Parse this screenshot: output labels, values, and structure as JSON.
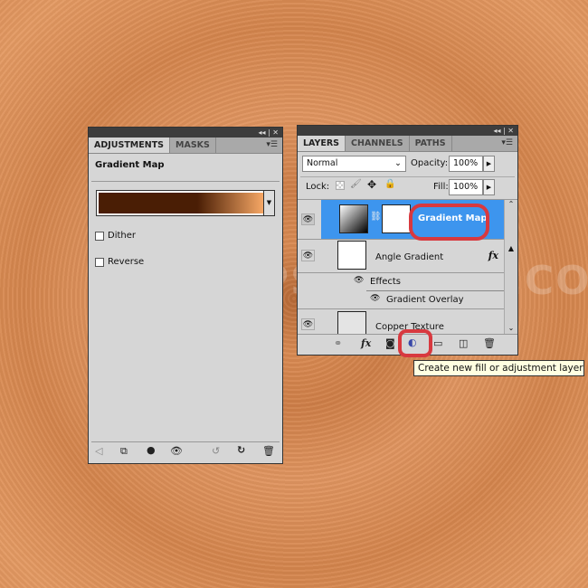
{
  "watermark": "WWW.PSD-DUDE.COM",
  "adjustments": {
    "tabs": [
      "ADJUSTMENTS",
      "MASKS"
    ],
    "title": "Gradient Map",
    "gradient_colors": [
      "#4a1e05",
      "#4a1e05",
      "#f6a765"
    ],
    "dither_label": "Dither",
    "dither_checked": false,
    "reverse_label": "Reverse",
    "reverse_checked": false,
    "toolbar_icons": [
      "back-arrow-icon",
      "expand-view-icon",
      "clip-layer-icon",
      "visibility-eye-icon",
      "view-previous-icon",
      "reset-icon",
      "trash-icon"
    ]
  },
  "layers": {
    "tabs": [
      "LAYERS",
      "CHANNELS",
      "PATHS"
    ],
    "blend_mode": "Normal",
    "opacity_label": "Opacity:",
    "opacity": "100%",
    "lock_label": "Lock:",
    "fill_label": "Fill:",
    "fill": "100%",
    "items": [
      {
        "name": "Gradient Map",
        "selected": true
      },
      {
        "name": "Angle Gradient",
        "fx": "fx"
      },
      {
        "name": "Effects"
      },
      {
        "name": "Gradient Overlay"
      },
      {
        "name": "Copper Texture"
      }
    ],
    "tooltip": "Create new fill or adjustment layer",
    "selected_color": "#3d95ee",
    "highlight_color": "#d8393f"
  }
}
